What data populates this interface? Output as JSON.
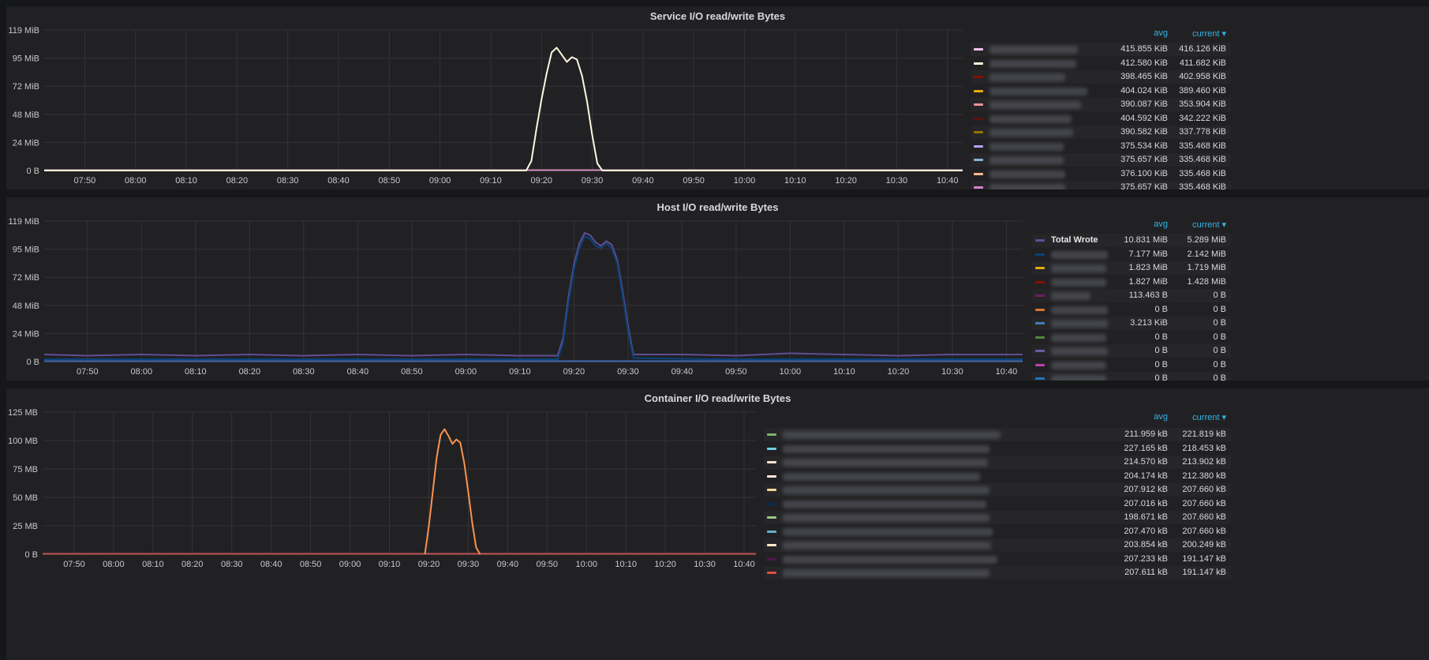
{
  "panels": [
    {
      "id": "service",
      "title": "Service I/O read/write Bytes",
      "legend_headers": {
        "avg": "avg",
        "current": "current ▾"
      },
      "chart_data": {
        "type": "line",
        "title": "Service I/O read/write Bytes",
        "y_ticks": [
          "0 B",
          "24 MiB",
          "48 MiB",
          "72 MiB",
          "95 MiB",
          "119 MiB"
        ],
        "ylim": [
          0,
          119
        ],
        "x_ticks": [
          "07:50",
          "08:00",
          "08:10",
          "08:20",
          "08:30",
          "08:40",
          "08:50",
          "09:00",
          "09:10",
          "09:20",
          "09:30",
          "09:40",
          "09:50",
          "10:00",
          "10:10",
          "10:20",
          "10:30",
          "10:40"
        ],
        "xlim": [
          "07:42",
          "10:43"
        ],
        "grid": true,
        "legend_position": "right",
        "series": [
          {
            "color": "#f6c3f0",
            "avg": "415.855 KiB",
            "current": "416.126 KiB",
            "values": []
          },
          {
            "color": "#fff8dc",
            "avg": "412.580 KiB",
            "current": "411.682 KiB",
            "values": [
              [
                "09:17",
                0
              ],
              [
                "09:18",
                8
              ],
              [
                "09:19",
                35
              ],
              [
                "09:20",
                60
              ],
              [
                "09:21",
                82
              ],
              [
                "09:22",
                100
              ],
              [
                "09:23",
                104
              ],
              [
                "09:24",
                98
              ],
              [
                "09:25",
                92
              ],
              [
                "09:26",
                96
              ],
              [
                "09:27",
                94
              ],
              [
                "09:28",
                80
              ],
              [
                "09:29",
                58
              ],
              [
                "09:30",
                30
              ],
              [
                "09:31",
                6
              ],
              [
                "09:32",
                0
              ]
            ]
          },
          {
            "color": "#890f02",
            "avg": "398.465 KiB",
            "current": "402.958 KiB",
            "values": []
          },
          {
            "color": "#e5ac0e",
            "avg": "404.024 KiB",
            "current": "389.460 KiB",
            "values": []
          },
          {
            "color": "#f29191",
            "avg": "390.087 KiB",
            "current": "353.904 KiB",
            "values": []
          },
          {
            "color": "#58140c",
            "avg": "404.592 KiB",
            "current": "342.222 KiB",
            "values": []
          },
          {
            "color": "#967302",
            "avg": "390.582 KiB",
            "current": "337.778 KiB",
            "values": []
          },
          {
            "color": "#ba9ff9",
            "avg": "375.534 KiB",
            "current": "335.468 KiB",
            "values": []
          },
          {
            "color": "#82b5d8",
            "avg": "375.657 KiB",
            "current": "335.468 KiB",
            "values": []
          },
          {
            "color": "#f9ba8f",
            "avg": "376.100 KiB",
            "current": "335.468 KiB",
            "values": []
          },
          {
            "color": "#d683ce",
            "avg": "375.657 KiB",
            "current": "335.468 KiB",
            "values": []
          }
        ]
      }
    },
    {
      "id": "host",
      "title": "Host I/O read/write Bytes",
      "legend_headers": {
        "avg": "avg",
        "current": "current ▾"
      },
      "chart_data": {
        "type": "line",
        "title": "Host I/O read/write Bytes",
        "y_ticks": [
          "0 B",
          "24 MiB",
          "48 MiB",
          "72 MiB",
          "95 MiB",
          "119 MiB"
        ],
        "ylim": [
          0,
          119
        ],
        "x_ticks": [
          "07:50",
          "08:00",
          "08:10",
          "08:20",
          "08:30",
          "08:40",
          "08:50",
          "09:00",
          "09:10",
          "09:20",
          "09:30",
          "09:40",
          "09:50",
          "10:00",
          "10:10",
          "10:20",
          "10:30",
          "10:40"
        ],
        "xlim": [
          "07:42",
          "10:43"
        ],
        "grid": true,
        "legend_position": "right",
        "series": [
          {
            "name": "Total Wrote",
            "color": "#614d93",
            "avg": "10.831 MiB",
            "current": "5.289 MiB",
            "values": [
              [
                "07:42",
                6
              ],
              [
                "07:50",
                5
              ],
              [
                "08:00",
                6
              ],
              [
                "08:10",
                5
              ],
              [
                "08:20",
                6
              ],
              [
                "08:30",
                5
              ],
              [
                "08:40",
                6
              ],
              [
                "08:50",
                5
              ],
              [
                "09:00",
                6
              ],
              [
                "09:10",
                5
              ],
              [
                "09:17",
                5
              ],
              [
                "09:18",
                20
              ],
              [
                "09:19",
                55
              ],
              [
                "09:20",
                82
              ],
              [
                "09:21",
                100
              ],
              [
                "09:22",
                109
              ],
              [
                "09:23",
                107
              ],
              [
                "09:24",
                101
              ],
              [
                "09:25",
                98
              ],
              [
                "09:26",
                102
              ],
              [
                "09:27",
                99
              ],
              [
                "09:28",
                86
              ],
              [
                "09:29",
                60
              ],
              [
                "09:30",
                30
              ],
              [
                "09:31",
                6
              ],
              [
                "09:40",
                6
              ],
              [
                "09:50",
                5
              ],
              [
                "10:00",
                7
              ],
              [
                "10:10",
                6
              ],
              [
                "10:20",
                5
              ],
              [
                "10:30",
                6
              ],
              [
                "10:43",
                6
              ]
            ]
          },
          {
            "color": "#0a437c",
            "avg": "7.177 MiB",
            "current": "2.142 MiB",
            "values": [
              [
                "07:42",
                2
              ],
              [
                "08:00",
                2
              ],
              [
                "08:30",
                2
              ],
              [
                "09:00",
                2
              ],
              [
                "09:17",
                2
              ],
              [
                "09:18",
                16
              ],
              [
                "09:19",
                50
              ],
              [
                "09:20",
                78
              ],
              [
                "09:21",
                96
              ],
              [
                "09:22",
                106
              ],
              [
                "09:23",
                104
              ],
              [
                "09:24",
                98
              ],
              [
                "09:25",
                96
              ],
              [
                "09:26",
                100
              ],
              [
                "09:27",
                96
              ],
              [
                "09:28",
                83
              ],
              [
                "09:29",
                56
              ],
              [
                "09:30",
                26
              ],
              [
                "09:31",
                3
              ],
              [
                "09:45",
                2
              ],
              [
                "10:15",
                2
              ],
              [
                "10:43",
                2
              ]
            ]
          },
          {
            "color": "#e5ac0e",
            "avg": "1.823 MiB",
            "current": "1.719 MiB",
            "values": []
          },
          {
            "color": "#890f02",
            "avg": "1.827 MiB",
            "current": "1.428 MiB",
            "values": []
          },
          {
            "color": "#6d1f62",
            "avg": "113.463 B",
            "current": "0 B",
            "values": []
          },
          {
            "color": "#e0752d",
            "avg": "0 B",
            "current": "0 B",
            "values": []
          },
          {
            "color": "#447ebc",
            "avg": "3.213 KiB",
            "current": "0 B",
            "values": []
          },
          {
            "color": "#508642",
            "avg": "0 B",
            "current": "0 B",
            "values": []
          },
          {
            "color": "#705da0",
            "avg": "0 B",
            "current": "0 B",
            "values": []
          },
          {
            "color": "#ba43a9",
            "avg": "0 B",
            "current": "0 B",
            "values": []
          },
          {
            "color": "#1f78c1",
            "avg": "0 B",
            "current": "0 B",
            "values": []
          }
        ]
      }
    },
    {
      "id": "container",
      "title": "Container I/O read/write Bytes",
      "legend_headers": {
        "avg": "avg",
        "current": "current ▾"
      },
      "chart_data": {
        "type": "line",
        "title": "Container I/O read/write Bytes",
        "y_ticks": [
          "0 B",
          "25 MB",
          "50 MB",
          "75 MB",
          "100 MB",
          "125 MB"
        ],
        "ylim": [
          0,
          125
        ],
        "x_ticks": [
          "07:50",
          "08:00",
          "08:10",
          "08:20",
          "08:30",
          "08:40",
          "08:50",
          "09:00",
          "09:10",
          "09:20",
          "09:30",
          "09:40",
          "09:50",
          "10:00",
          "10:10",
          "10:20",
          "10:30",
          "10:40"
        ],
        "xlim": [
          "07:42",
          "10:43"
        ],
        "grid": true,
        "legend_position": "right",
        "series": [
          {
            "color": "#7eb26d",
            "avg": "211.959 kB",
            "current": "221.819 kB",
            "values": []
          },
          {
            "color": "#6ed0e0",
            "avg": "227.165 kB",
            "current": "218.453 kB",
            "values": []
          },
          {
            "color": "#f9e2d2",
            "avg": "214.570 kB",
            "current": "213.902 kB",
            "values": []
          },
          {
            "color": "#fce2de",
            "avg": "204.174 kB",
            "current": "212.380 kB",
            "values": []
          },
          {
            "color": "#f4d598",
            "avg": "207.912 kB",
            "current": "207.660 kB",
            "values": []
          },
          {
            "color": "#052b51",
            "avg": "207.016 kB",
            "current": "207.660 kB",
            "values": []
          },
          {
            "color": "#9ac48a",
            "avg": "198.671 kB",
            "current": "207.660 kB",
            "values": []
          },
          {
            "color": "#64b0c8",
            "avg": "207.470 kB",
            "current": "207.660 kB",
            "values": []
          },
          {
            "color": "#fceaca",
            "avg": "203.854 kB",
            "current": "200.249 kB",
            "values": []
          },
          {
            "color": "#511749",
            "avg": "207.233 kB",
            "current": "191.147 kB",
            "values": []
          },
          {
            "color": "#e24d42",
            "avg": "207.611 kB",
            "current": "191.147 kB",
            "values": []
          }
        ],
        "spike_series": {
          "color": "#f9934e",
          "values": [
            [
              "09:19",
              0
            ],
            [
              "09:20",
              25
            ],
            [
              "09:21",
              55
            ],
            [
              "09:22",
              85
            ],
            [
              "09:23",
              105
            ],
            [
              "09:24",
              110
            ],
            [
              "09:25",
              104
            ],
            [
              "09:26",
              97
            ],
            [
              "09:27",
              101
            ],
            [
              "09:28",
              98
            ],
            [
              "09:29",
              80
            ],
            [
              "09:30",
              55
            ],
            [
              "09:31",
              28
            ],
            [
              "09:32",
              6
            ],
            [
              "09:33",
              0
            ]
          ]
        }
      }
    }
  ]
}
